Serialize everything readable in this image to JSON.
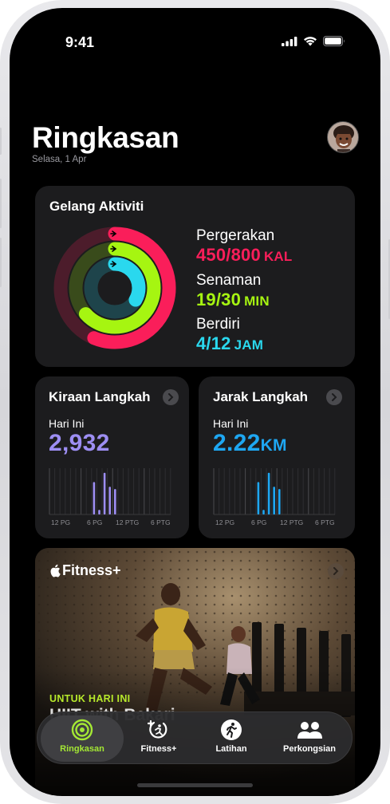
{
  "status": {
    "time": "9:41"
  },
  "header": {
    "title": "Ringkasan",
    "date": "Selasa, 1 Apr"
  },
  "activity": {
    "title": "Gelang Aktiviti",
    "move": {
      "label": "Pergerakan",
      "value": "450/800",
      "unit": "KAL",
      "color": "#fa1e5a",
      "progress": 0.5625
    },
    "exercise": {
      "label": "Senaman",
      "value": "19/30",
      "unit": "MIN",
      "color": "#a6f511",
      "progress": 0.633
    },
    "stand": {
      "label": "Berdiri",
      "value": "4/12",
      "unit": "JAM",
      "color": "#2ad8ee",
      "progress": 0.333
    }
  },
  "steps": {
    "title": "Kiraan Langkah",
    "today_label": "Hari Ini",
    "value": "2,932",
    "color": "#9d8ef3",
    "ticks": [
      "12 PG",
      "6 PG",
      "12 PTG",
      "6 PTG"
    ]
  },
  "distance": {
    "title": "Jarak Langkah",
    "today_label": "Hari Ini",
    "value": "2.22",
    "unit": "KM",
    "color": "#1ea7f2",
    "ticks": [
      "12 PG",
      "6 PG",
      "12 PTG",
      "6 PTG"
    ]
  },
  "fitness": {
    "logo_text": "Fitness+",
    "for_today": "UNTUK HARI INI",
    "workout_title": "HIIT with Bakari"
  },
  "tabs": [
    {
      "label": "Ringkasan",
      "icon": "summary-rings-icon",
      "active": true
    },
    {
      "label": "Fitness+",
      "icon": "fitness-plus-icon",
      "active": false
    },
    {
      "label": "Latihan",
      "icon": "workout-runner-icon",
      "active": false
    },
    {
      "label": "Perkongsian",
      "icon": "sharing-people-icon",
      "active": false
    }
  ]
}
